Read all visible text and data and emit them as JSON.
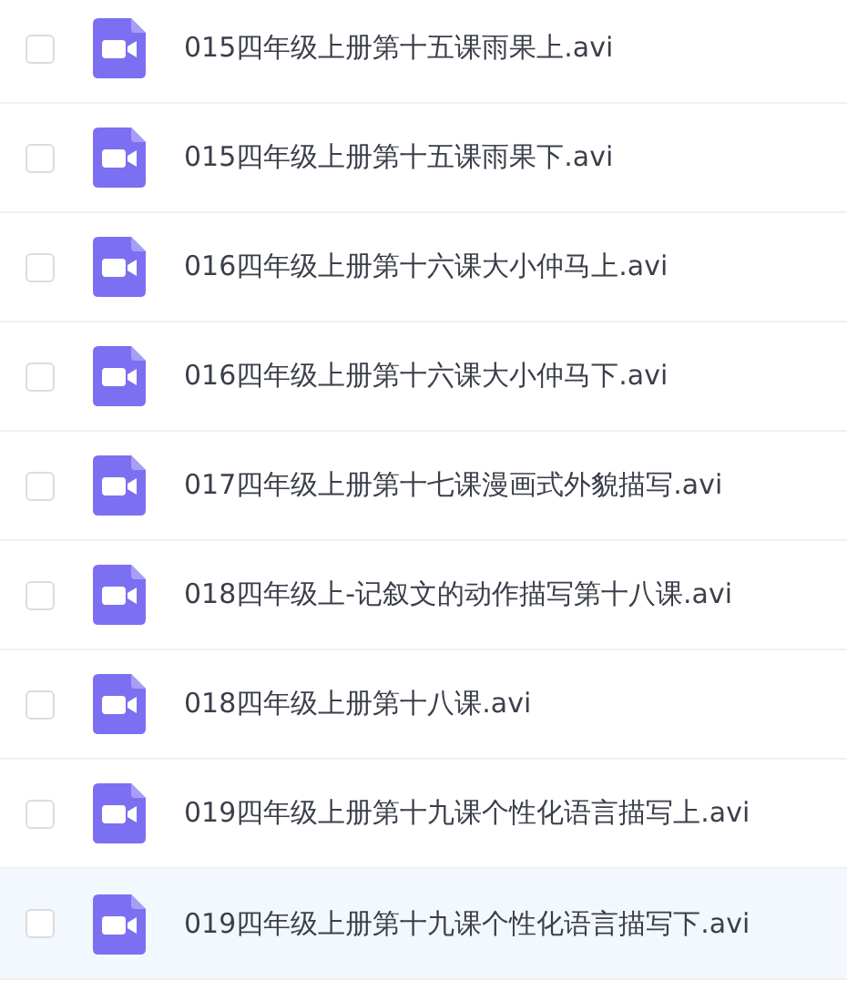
{
  "files": [
    {
      "name": "015四年级上册第十五课雨果上.avi",
      "checked": false,
      "highlighted": false
    },
    {
      "name": "015四年级上册第十五课雨果下.avi",
      "checked": false,
      "highlighted": false
    },
    {
      "name": "016四年级上册第十六课大小仲马上.avi",
      "checked": false,
      "highlighted": false
    },
    {
      "name": "016四年级上册第十六课大小仲马下.avi",
      "checked": false,
      "highlighted": false
    },
    {
      "name": "017四年级上册第十七课漫画式外貌描写.avi",
      "checked": false,
      "highlighted": false
    },
    {
      "name": "018四年级上-记叙文的动作描写第十八课.avi",
      "checked": false,
      "highlighted": false
    },
    {
      "name": "018四年级上册第十八课.avi",
      "checked": false,
      "highlighted": false
    },
    {
      "name": "019四年级上册第十九课个性化语言描写上.avi",
      "checked": false,
      "highlighted": false
    },
    {
      "name": "019四年级上册第十九课个性化语言描写下.avi",
      "checked": false,
      "highlighted": true
    }
  ]
}
